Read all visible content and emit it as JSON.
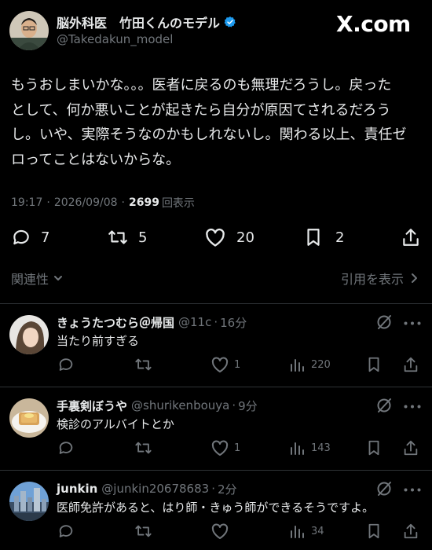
{
  "brand": {
    "watermark": "X.com"
  },
  "main_post": {
    "display_name": "脳外科医　竹田くんのモデル",
    "handle": "@Takedakun_model",
    "body_lines": [
      "もうおしまいかな。。。医者に戻るのも無理だろうし。戻った",
      "として、何か悪いことが起きたら自分が原因てされるだろう",
      "し。いや、実際そうなのかもしれないし。関わる以上、責任ゼ",
      "ロってことはないからな。"
    ],
    "time": "19:17",
    "date": "2026/09/08",
    "views": "2699",
    "views_label": "回表示",
    "stats": {
      "replies": "7",
      "reposts": "5",
      "likes": "20",
      "bookmarks": "2"
    }
  },
  "filters": {
    "relevance": "関連性",
    "quotes": "引用を表示"
  },
  "replies": [
    {
      "name": "きょうたつむら＠帰国",
      "handle": "@11c",
      "age": "16分",
      "text": "当たり前すぎる",
      "likes": "1",
      "views": "220"
    },
    {
      "name": "手裏剣ぼうや",
      "handle": "@shurikenbouya",
      "age": "9分",
      "text": "検診のアルバイトとか",
      "likes": "1",
      "views": "143"
    },
    {
      "name": "junkin",
      "handle": "@junkin20678683",
      "age": "2分",
      "text": "医師免許があると、はり師・きゅう師ができるそうですよ。",
      "likes": "",
      "views": "34"
    }
  ]
}
